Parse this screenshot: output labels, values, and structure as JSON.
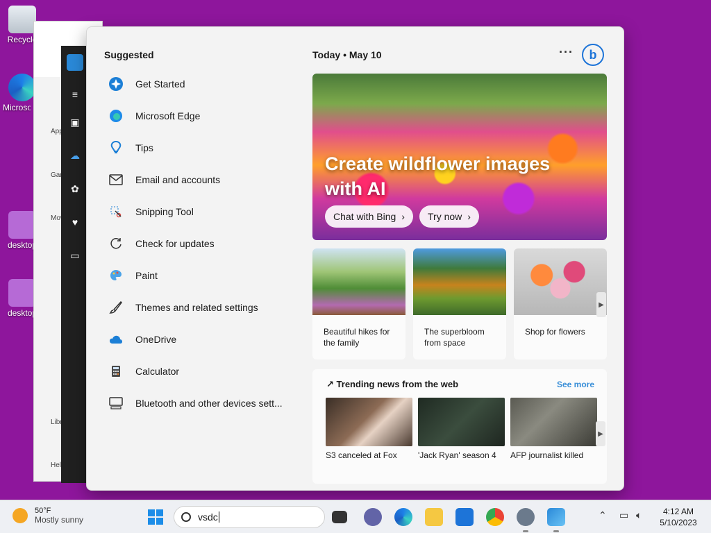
{
  "desktop": {
    "icons": [
      {
        "label": "Recycle",
        "icon": "recycle-bin-icon"
      },
      {
        "label": "Microsoft Edge",
        "icon": "edge-icon"
      },
      {
        "label": "desktop",
        "icon": "settings-file-icon"
      },
      {
        "label": "desktop",
        "icon": "settings-file-icon"
      }
    ]
  },
  "background_windows": {
    "store_nav": [
      "Apps",
      "Gaming",
      "Movies",
      "Library",
      "Help"
    ]
  },
  "search_panel": {
    "suggested_title": "Suggested",
    "suggested": [
      {
        "label": "Get Started",
        "icon": "get-started-icon"
      },
      {
        "label": "Microsoft Edge",
        "icon": "edge-icon"
      },
      {
        "label": "Tips",
        "icon": "tips-icon"
      },
      {
        "label": "Email and accounts",
        "icon": "mail-icon"
      },
      {
        "label": "Snipping Tool",
        "icon": "scissors-icon"
      },
      {
        "label": "Check for updates",
        "icon": "refresh-icon"
      },
      {
        "label": "Paint",
        "icon": "palette-icon"
      },
      {
        "label": "Themes and related settings",
        "icon": "brush-icon"
      },
      {
        "label": "OneDrive",
        "icon": "cloud-icon"
      },
      {
        "label": "Calculator",
        "icon": "calculator-icon"
      },
      {
        "label": "Bluetooth and other devices sett...",
        "icon": "devices-icon"
      }
    ],
    "today_label": "Today",
    "date": "May 10",
    "more_label": "···",
    "bing_label": "b",
    "hero": {
      "title": "Create wildflower images with AI",
      "buttons": [
        "Chat with Bing",
        "Try now"
      ]
    },
    "cards": [
      {
        "caption": "Beautiful hikes for the family"
      },
      {
        "caption": "The superbloom from space"
      },
      {
        "caption": "Shop for flowers"
      }
    ],
    "trending": {
      "title": "Trending news from the web",
      "see_more": "See more",
      "items": [
        {
          "caption": "S3 canceled at Fox"
        },
        {
          "caption": "'Jack Ryan' season 4"
        },
        {
          "caption": "AFP journalist killed"
        }
      ]
    }
  },
  "taskbar": {
    "weather_temp": "50°F",
    "weather_desc": "Mostly sunny",
    "search_value": "vsdc",
    "time": "4:12 AM",
    "date": "5/10/2023"
  }
}
